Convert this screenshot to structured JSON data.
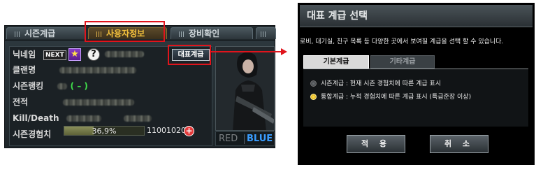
{
  "left_panel": {
    "tabs": [
      {
        "label": "시즌계급",
        "active": false
      },
      {
        "label": "사용자정보",
        "active": true
      },
      {
        "label": "장비확인",
        "active": false
      }
    ],
    "fields": {
      "nickname_label": "닉네임",
      "next_badge": "NEXT",
      "star_icon": "★",
      "help_icon": "?",
      "clan_label": "클랜명",
      "season_rank_label": "시즌랭킹",
      "season_rank_suffix": "( – )",
      "record_label": "전적",
      "kd_label": "Kill/Death",
      "exp_label": "시즌경험치"
    },
    "representative_button": "대표계급",
    "exp": {
      "percent_text": "36,9%",
      "fraction": 0.369,
      "points": "11001020",
      "plus_icon": "+"
    },
    "team": {
      "red": "RED",
      "blue": "BLUE"
    }
  },
  "dialog": {
    "title": "대표 계급 선택",
    "description": "로비, 대기실, 친구 목록 등 다양한 곳에서 보여질 계급을  선택 할 수 있습니다.",
    "tabs": [
      {
        "label": "기본계급",
        "active": true
      },
      {
        "label": "기타계급",
        "active": false
      }
    ],
    "options": [
      {
        "label": "시즌계급 :  현재 시즌 경험치에 따른 계급 표시",
        "selected": false
      },
      {
        "label": "통합계급 :  누적 경험치에 따른 계급 표시 (특급준장 이상)",
        "selected": true
      }
    ],
    "buttons": {
      "apply": "적 용",
      "cancel": "취 소"
    }
  },
  "colors": {
    "highlight": "#e0141c",
    "active_tab": "#f3c13c",
    "blue_team": "#3a9dff",
    "rank_green": "#3fdc4a"
  }
}
